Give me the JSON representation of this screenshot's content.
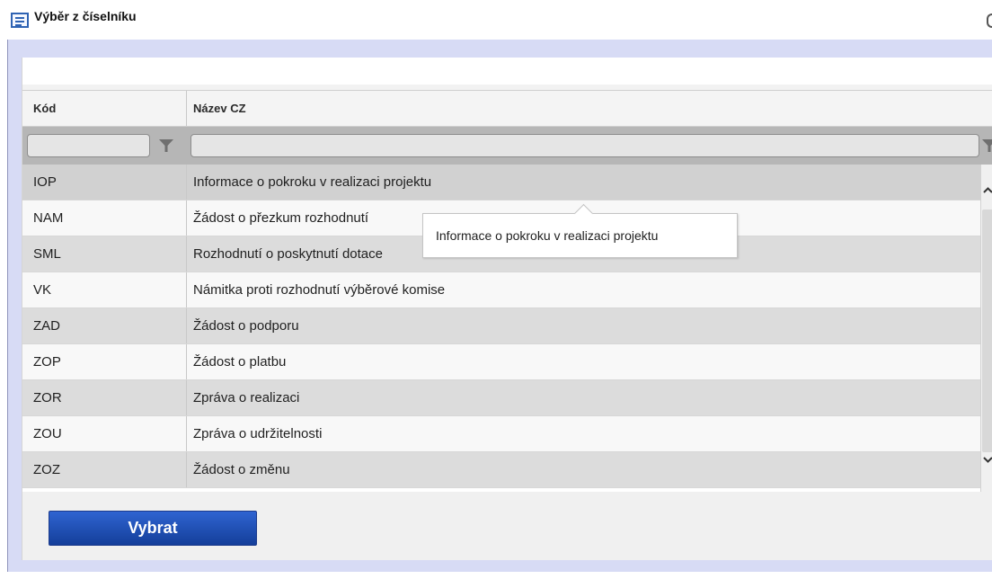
{
  "window": {
    "title": "Výběr z číselníku",
    "icon": "list-window-icon"
  },
  "table": {
    "columns": [
      {
        "label": "Kód"
      },
      {
        "label": "Název CZ"
      }
    ],
    "filters": {
      "code_value": "",
      "name_value": ""
    },
    "rows": [
      {
        "code": "IOP",
        "name": "Informace o pokroku v realizaci projektu",
        "selected": true
      },
      {
        "code": "NAM",
        "name": "Žádost o přezkum rozhodnutí"
      },
      {
        "code": "SML",
        "name": "Rozhodnutí o poskytnutí dotace"
      },
      {
        "code": "VK",
        "name": "Námitka proti rozhodnutí výběrové komise"
      },
      {
        "code": "ZAD",
        "name": "Žádost o podporu"
      },
      {
        "code": "ZOP",
        "name": "Žádost o platbu"
      },
      {
        "code": "ZOR",
        "name": "Zpráva o realizaci"
      },
      {
        "code": "ZOU",
        "name": "Zpráva o udržitelnosti"
      },
      {
        "code": "ZOZ",
        "name": "Žádost o změnu"
      }
    ]
  },
  "tooltip": {
    "text": "Informace o pokroku v realizaci projektu"
  },
  "actions": {
    "select_label": "Vybrat"
  },
  "colors": {
    "primary_button": "#1f4fb3",
    "dialog_background": "#d7dbf5",
    "selected_row": "#d1d1d1"
  }
}
